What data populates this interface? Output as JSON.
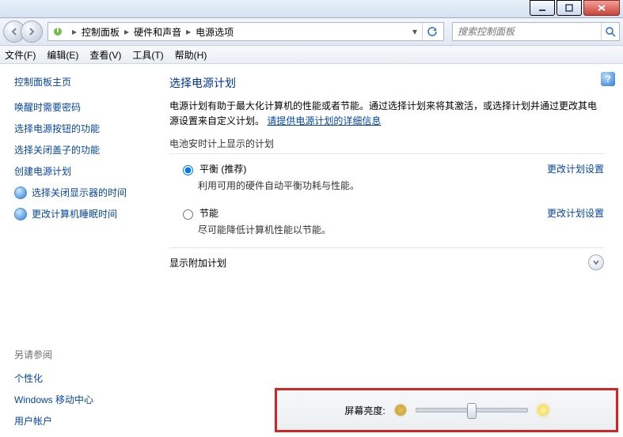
{
  "window": {
    "min_tip": "minimize",
    "max_tip": "maximize",
    "close_tip": "close"
  },
  "breadcrumb": {
    "first_icon": "power-icon",
    "items": [
      "控制面板",
      "硬件和声音",
      "电源选项"
    ]
  },
  "search": {
    "placeholder": "搜索控制面板"
  },
  "menu": {
    "file": "文件(F)",
    "edit": "编辑(E)",
    "view": "查看(V)",
    "tools": "工具(T)",
    "help": "帮助(H)"
  },
  "side": {
    "home": "控制面板主页",
    "links": [
      "唤醒时需要密码",
      "选择电源按钮的功能",
      "选择关闭盖子的功能",
      "创建电源计划"
    ],
    "shield_links": [
      "选择关闭显示器的时间",
      "更改计算机睡眠时间"
    ],
    "seealso_title": "另请参阅",
    "seealso": [
      "个性化",
      "Windows 移动中心",
      "用户帐户"
    ]
  },
  "main": {
    "title": "选择电源计划",
    "desc_pre": "电源计划有助于最大化计算机的性能或者节能。通过选择计划来将其激活，或选择计划并通过更改其电源设置来自定义计划。",
    "desc_link": "请提供电源计划的详细信息",
    "section_battery": "电池安时计上显示的计划",
    "plans": [
      {
        "name": "平衡 (推荐)",
        "desc": "利用可用的硬件自动平衡功耗与性能。",
        "checked": true
      },
      {
        "name": "节能",
        "desc": "尽可能降低计算机性能以节能。",
        "checked": false
      }
    ],
    "change_link": "更改计划设置",
    "section_extra": "显示附加计划"
  },
  "brightness": {
    "label": "屏幕亮度:"
  }
}
